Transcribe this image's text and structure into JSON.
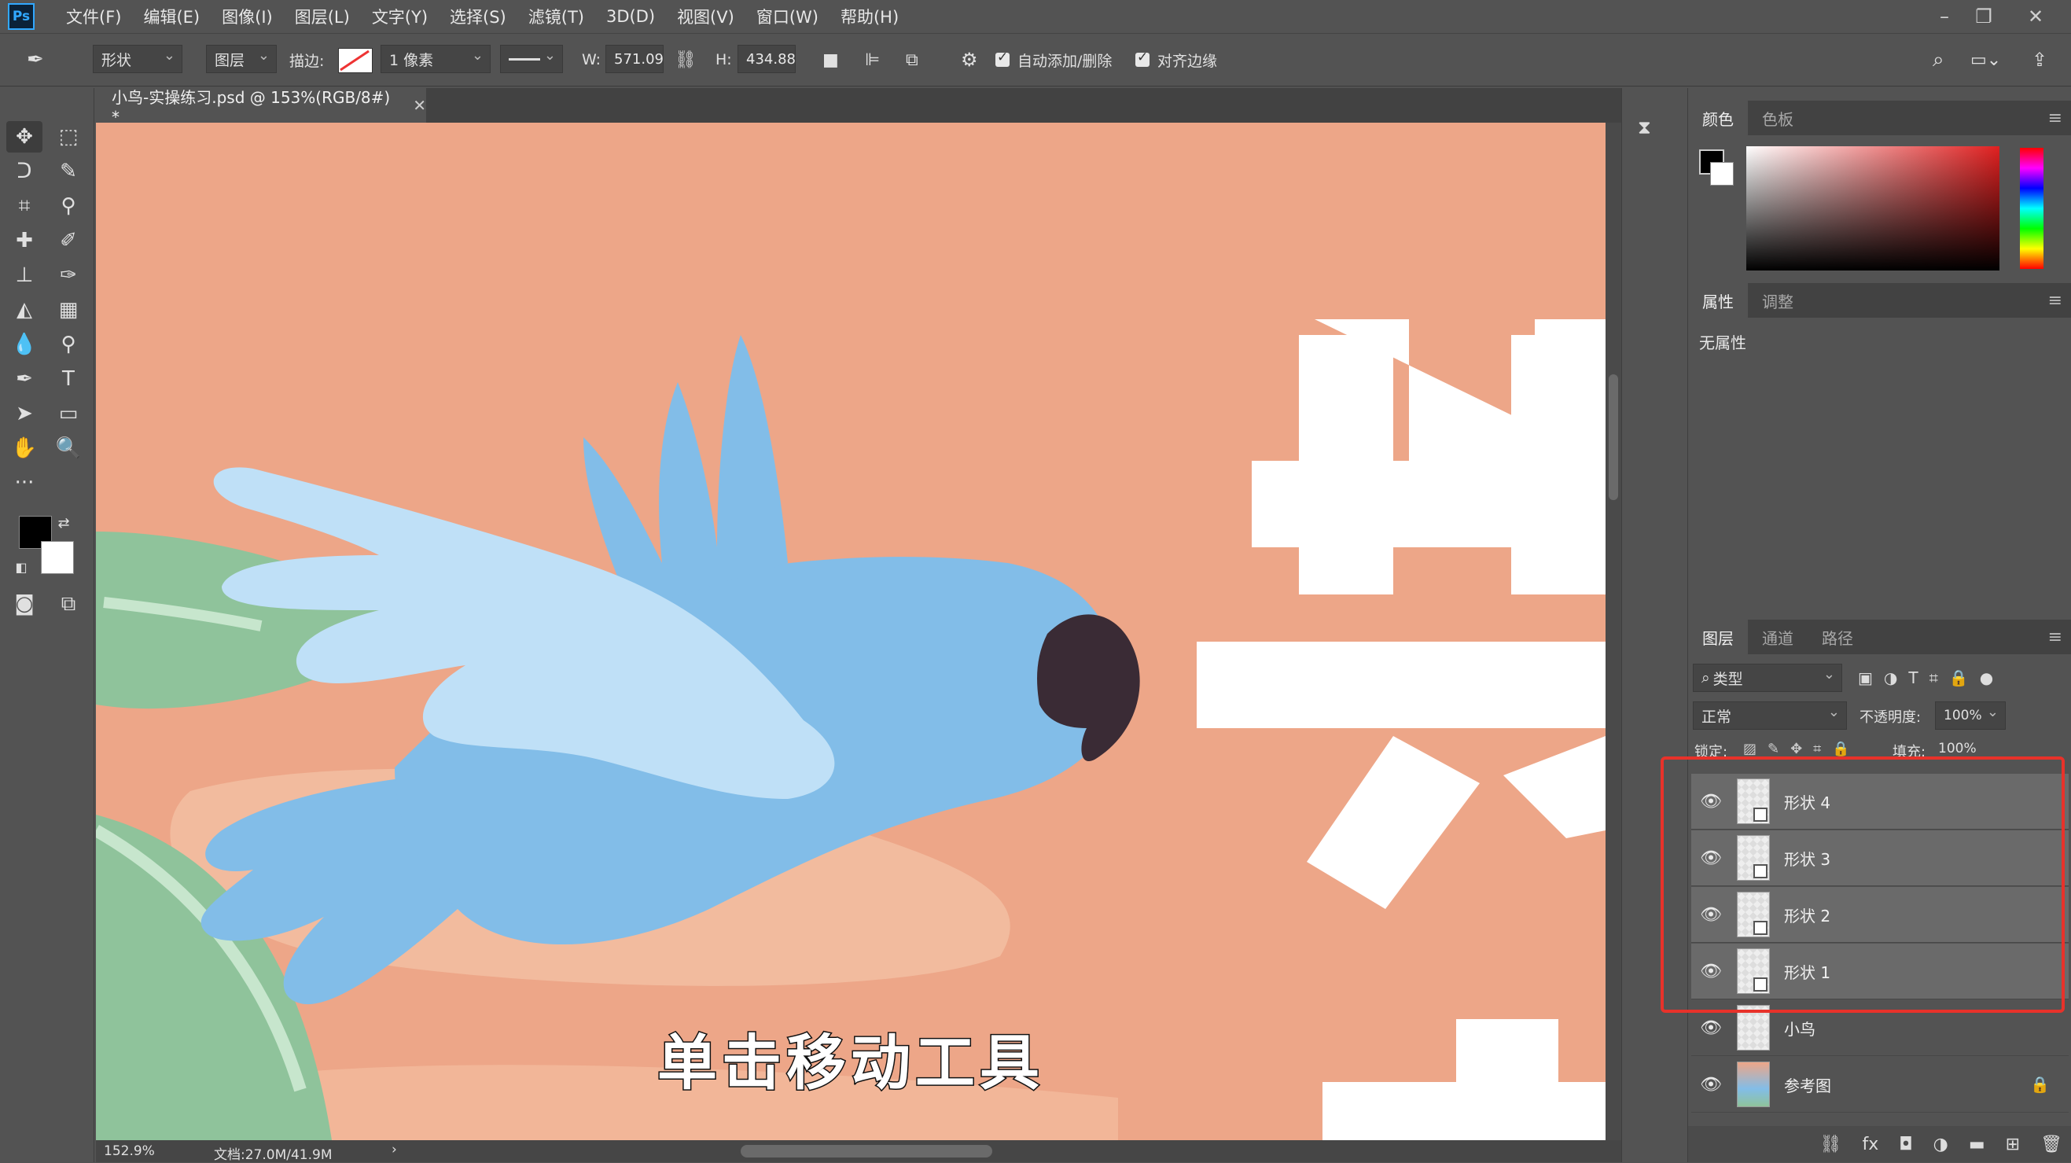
{
  "app": {
    "logo": "Ps"
  },
  "menu": [
    "文件(F)",
    "编辑(E)",
    "图像(I)",
    "图层(L)",
    "文字(Y)",
    "选择(S)",
    "滤镜(T)",
    "3D(D)",
    "视图(V)",
    "窗口(W)",
    "帮助(H)"
  ],
  "options": {
    "mode": "形状",
    "target": "图层",
    "stroke_label": "描边:",
    "stroke_width": "1 像素",
    "w_label": "W:",
    "w_value": "571.09",
    "h_label": "H:",
    "h_value": "434.88",
    "auto_add_label": "自动添加/删除",
    "align_edges_label": "对齐边缘"
  },
  "document": {
    "tab_title": "小鸟-实操练习.psd @ 153%(RGB/8#) *"
  },
  "status": {
    "zoom": "152.9%",
    "doc_size": "文档:27.0M/41.9M"
  },
  "subtitle": "单击移动工具",
  "panels": {
    "color": {
      "tabs": [
        "颜色",
        "色板"
      ]
    },
    "properties": {
      "tabs": [
        "属性",
        "调整"
      ],
      "empty_text": "无属性"
    },
    "layers": {
      "tabs": [
        "图层",
        "通道",
        "路径"
      ],
      "filter": "类型",
      "blend_mode": "正常",
      "opacity_label": "不透明度:",
      "opacity": "100%",
      "lock_label": "锁定:",
      "fill_label": "填充:",
      "fill": "100%",
      "items": [
        {
          "name": "形状 4",
          "selected": true
        },
        {
          "name": "形状 3",
          "selected": true
        },
        {
          "name": "形状 2",
          "selected": true
        },
        {
          "name": "形状 1",
          "selected": true
        },
        {
          "name": "小鸟",
          "selected": false
        },
        {
          "name": "参考图",
          "selected": false,
          "locked": true
        }
      ]
    }
  },
  "colors": {
    "highlight_box": "#e8322a",
    "canvas_bg": "#eda688",
    "bird_light": "#bfe0f7",
    "bird_body": "#82bde8",
    "beak": "#3a2b35"
  }
}
